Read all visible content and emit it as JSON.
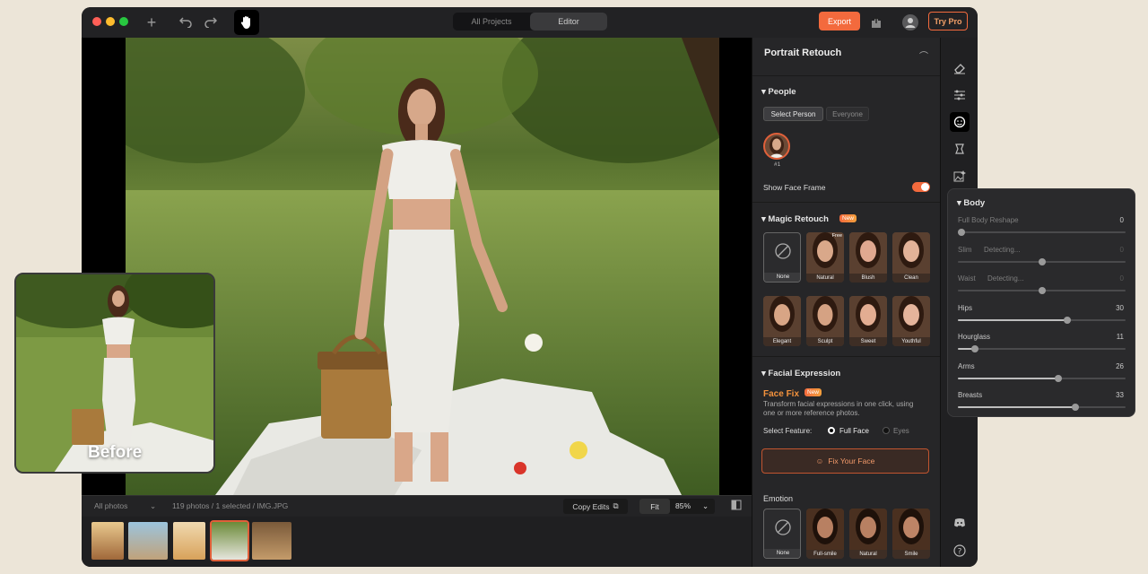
{
  "titlebar": {
    "tabs": [
      {
        "label": "All Projects",
        "active": false
      },
      {
        "label": "Editor",
        "active": true
      }
    ],
    "export_label": "Export",
    "try_pro_label": "Try Pro"
  },
  "filmstrip": {
    "filter_label": "All photos",
    "status": "119 photos / 1 selected / IMG.JPG",
    "copy_edits_label": "Copy Edits",
    "fit_label": "Fit",
    "zoom": "85%"
  },
  "panel": {
    "title": "Portrait Retouch",
    "people": {
      "title": "People",
      "select_person": "Select Person",
      "everyone": "Everyone",
      "person_label": "#1",
      "show_face_frame": "Show Face Frame",
      "show_face_frame_on": true
    },
    "magic": {
      "title": "Magic Retouch",
      "badge": "New",
      "free_badge": "Free",
      "styles": [
        "None",
        "Natural",
        "Blush",
        "Clean",
        "Elegant",
        "Sculpt",
        "Sweet",
        "Youthful"
      ]
    },
    "facial": {
      "title": "Facial Expression",
      "face_fix": "Face Fix",
      "badge": "New",
      "desc_line1": "Transform facial expressions in one click, using",
      "desc_line2": "one or more reference photos.",
      "select_feature": "Select Feature:",
      "options": [
        "Full Face",
        "Eyes"
      ],
      "selected_option": "Full Face",
      "fix_button": "Fix Your Face",
      "emotion_title": "Emotion",
      "emotions": [
        "None",
        "Full-smile",
        "Natural",
        "Smile"
      ]
    }
  },
  "before_label": "Before",
  "body": {
    "title": "Body",
    "sliders": [
      {
        "label": "Full Body Reshape",
        "value": "0",
        "dim": true,
        "status": "",
        "fraction": 0.0
      },
      {
        "label": "Slim",
        "value": "0",
        "dim": true,
        "status": "Detecting...",
        "fraction": 0.5
      },
      {
        "label": "Waist",
        "value": "0",
        "dim": true,
        "status": "Detecting...",
        "fraction": 0.5
      },
      {
        "label": "Hips",
        "value": "30",
        "dim": false,
        "status": "",
        "fraction": 0.65
      },
      {
        "label": "Hourglass",
        "value": "11",
        "dim": false,
        "status": "",
        "fraction": 0.1
      },
      {
        "label": "Arms",
        "value": "26",
        "dim": false,
        "status": "",
        "fraction": 0.6
      },
      {
        "label": "Breasts",
        "value": "33",
        "dim": false,
        "status": "",
        "fraction": 0.7
      }
    ]
  },
  "colors": {
    "accent": "#f36a3d",
    "panel_bg": "#262628"
  }
}
